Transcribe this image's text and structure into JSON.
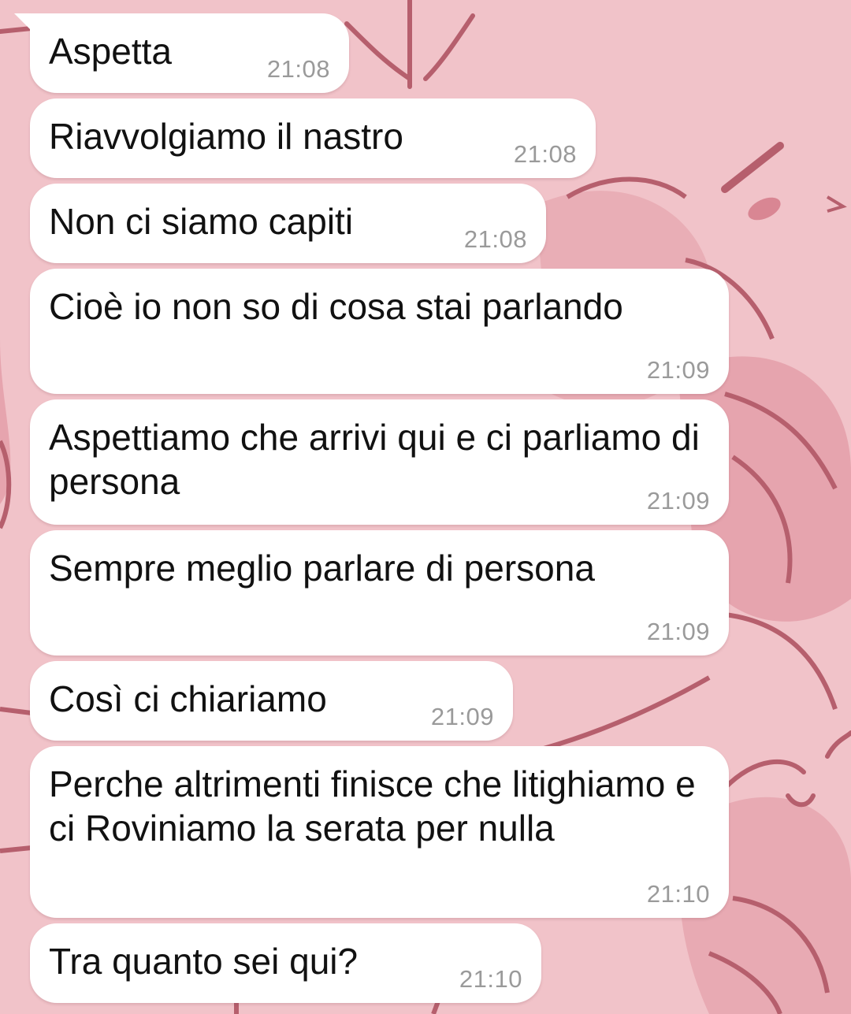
{
  "colors": {
    "wallpaper": "#f1c3c9",
    "wallpaper_shape": "#e6a4ae",
    "wallpaper_line": "#b65f6d",
    "bubble": "#ffffff",
    "text": "#111111",
    "time": "#9a9a9a"
  },
  "messages": [
    {
      "text": "Aspetta",
      "time": "21:08"
    },
    {
      "text": "Riavvolgiamo il nastro",
      "time": "21:08"
    },
    {
      "text": "Non ci siamo capiti",
      "time": "21:08"
    },
    {
      "text": "Cioè io non so di cosa stai parlando",
      "time": "21:09"
    },
    {
      "text": "Aspettiamo che arrivi qui e ci parliamo di persona",
      "time": "21:09"
    },
    {
      "text": "Sempre meglio parlare di persona",
      "time": "21:09"
    },
    {
      "text": "Così ci chiariamo",
      "time": "21:09"
    },
    {
      "text": "Perche altrimenti finisce che litighiamo e ci Roviniamo la serata per nulla",
      "time": "21:10"
    },
    {
      "text": "Tra quanto sei qui?",
      "time": "21:10"
    }
  ]
}
